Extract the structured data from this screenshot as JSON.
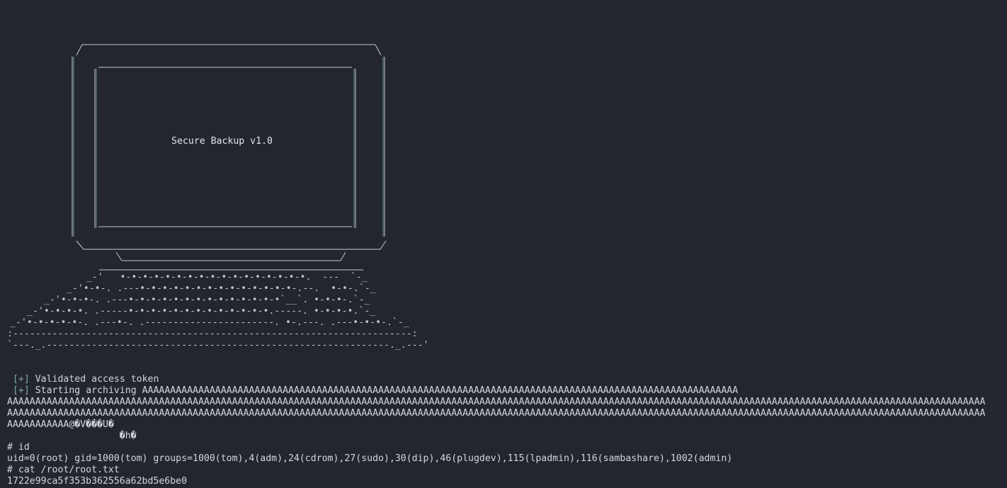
{
  "screen": {
    "title": "Secure Backup v1.0"
  },
  "keyboard": {
    "rows": [
      "   _-'   •-•-•-•-•-•-•-•-•-•-•-•-•-•-•-•-•.  ---  `-_",
      " _-'•-•-. .---•-•-•-•-•-•-•-•-•-•-•-•-•-•-.--.  •-•-.`-_",
      "_-'•-•-•-. .---•-•-•-•-•-•-•-•-•-•-•-•-•-•`__`. •-•-•-.`-_",
      "_-'•-•-•-•. .-----•-•-•-•-•-•-•-•-•-•-•-•-•.-----. •-•-•-•.`-_",
      "_-'•-•-•-•-•-. .---•-. .-----------------------. •-.---. .---•-•-•-.`-_",
      ":-----------------------------------------------------------------------:",
      "`---._.-------------------------------------------------------------._.---'"
    ]
  },
  "output": {
    "validated_prefix": "[+]",
    "validated_text": "Validated access token",
    "archiving_prefix": "[+]",
    "archiving_text": "Starting archiving AAAAAAAAAAAAAAAAAAAAAAAAAAAAAAAAAAAAAAAAAAAAAAAAAAAAAAAAAAAAAAAAAAAAAAAAAAAAAAAAAAAAAAAAAAAAAAAAAAAAAAAAAA",
    "a_line_1": "AAAAAAAAAAAAAAAAAAAAAAAAAAAAAAAAAAAAAAAAAAAAAAAAAAAAAAAAAAAAAAAAAAAAAAAAAAAAAAAAAAAAAAAAAAAAAAAAAAAAAAAAAAAAAAAAAAAAAAAAAAAAAAAAAAAAAAAAAAAAAAAAAAAAAAAAAAAAAAAAAAAAAAAAAAAAAA",
    "a_line_2": "AAAAAAAAAAAAAAAAAAAAAAAAAAAAAAAAAAAAAAAAAAAAAAAAAAAAAAAAAAAAAAAAAAAAAAAAAAAAAAAAAAAAAAAAAAAAAAAAAAAAAAAAAAAAAAAAAAAAAAAAAAAAAAAAAAAAAAAAAAAAAAAAAAAAAAAAAAAAAAAAAAAAAAAAAAAAAA",
    "a_line_3": "AAAAAAAAAAAAAAAAAAAAAAAAAAAAAAAAAAAAAAAAAAAAAAAAAAAAAAAAAAAAAAAAAAAAAAAAAAAAAAAAAAAAAAAAAAAAAAAAAAAAAAAAAAAAAAAAAAAAAAAAAAAAAAAAAAAAAAAAAAAAAAAAAAAAAAAAAAAAAAAAAAAAAAAAAAAAAA",
    "a_line_4": "AAAAAAAAAAA@�V���U�",
    "garbage_line": "                    �h�",
    "cmd_id": "# id",
    "id_result": "uid=0(root) gid=1000(tom) groups=1000(tom),4(adm),24(cdrom),27(sudo),30(dip),46(plugdev),115(lpadmin),116(sambashare),1002(admin)",
    "cmd_cat": "# cat /root/root.txt",
    "flag": "1722e99ca5f353b362556a62bd5e6be0"
  },
  "colors": {
    "background": "#23262f",
    "text": "#d4d6dc",
    "bracket": "#7fa7a5",
    "art": "#c5c8cf"
  }
}
